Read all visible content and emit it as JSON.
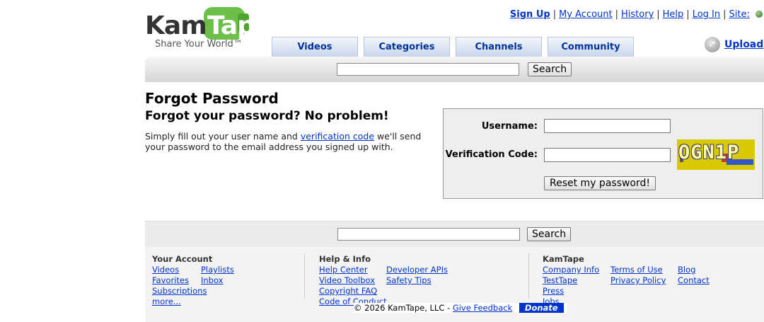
{
  "logo": {
    "kam": "Kam",
    "tape": "Tape",
    "tagline": "Share Your World™"
  },
  "top_links": {
    "sign_up": "Sign Up",
    "my_account": "My Account",
    "history": "History",
    "help": "Help",
    "log_in": "Log In",
    "site": "Site:",
    "separator": "|"
  },
  "tabs": [
    "Videos",
    "Categories",
    "Channels",
    "Community"
  ],
  "upload": {
    "label": "Upload",
    "icon": "upload-arrow-icon"
  },
  "search": {
    "button": "Search",
    "value": ""
  },
  "content": {
    "title": "Forgot Password",
    "subheading": "Forgot your password? No problem!",
    "intro_before": "Simply fill out your user name and ",
    "intro_link": "verification code",
    "intro_after": " we'll send your password to the email address you signed up with."
  },
  "form": {
    "username_label": "Username:",
    "verification_label": "Verification Code:",
    "captcha_text": "OGN1P",
    "reset_button": "Reset my password!"
  },
  "footer": {
    "your_account": {
      "title": "Your  Account",
      "links": [
        "Videos",
        "Playlists",
        "Favorites",
        "Inbox",
        "Subscriptions",
        "more..."
      ]
    },
    "help_info": {
      "title": "Help & Info",
      "links": [
        "Help Center",
        "Developer APIs",
        "Video Toolbox",
        "Safety Tips",
        "Copyright FAQ",
        "Code of Conduct"
      ]
    },
    "kamtape": {
      "title": "KamTape",
      "links": [
        "Company Info",
        "Terms of Use",
        "Blog",
        "TestTape",
        "Privacy Policy",
        "Contact",
        "Press",
        "Jobs"
      ]
    },
    "copyright": "© 2026 KamTape, LLC  -",
    "feedback": "Give Feedback",
    "donate": "Donate"
  },
  "colors": {
    "link": "#0033cc",
    "logo_green": "#6cc04a",
    "donate_bg": "#0033cc",
    "tab_text": "#003399"
  }
}
